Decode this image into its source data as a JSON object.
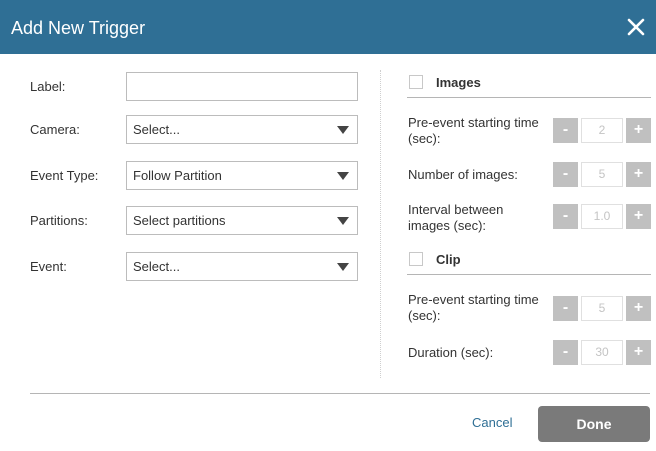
{
  "dialog": {
    "title": "Add New Trigger",
    "close_icon": "close-icon"
  },
  "form": {
    "label": {
      "label": "Label:",
      "value": "",
      "placeholder": ""
    },
    "camera": {
      "label": "Camera:",
      "value": "Select..."
    },
    "event_type": {
      "label": "Event Type:",
      "value": "Follow Partition"
    },
    "partitions": {
      "label": "Partitions:",
      "value": "Select partitions"
    },
    "event": {
      "label": "Event:",
      "value": "Select..."
    }
  },
  "images": {
    "title": "Images",
    "checked": false,
    "pre_event": {
      "label": "Pre-event starting time (sec):",
      "value": "2"
    },
    "count": {
      "label": "Number of images:",
      "value": "5"
    },
    "interval": {
      "label": "Interval between images (sec):",
      "value": "1.0"
    }
  },
  "clip": {
    "title": "Clip",
    "checked": false,
    "pre_event": {
      "label": "Pre-event starting time (sec):",
      "value": "5"
    },
    "duration": {
      "label": "Duration (sec):",
      "value": "30"
    }
  },
  "stepper": {
    "minus": "-",
    "plus": "+"
  },
  "footer": {
    "cancel": "Cancel",
    "done": "Done"
  },
  "colors": {
    "titlebar": "#2f6f95",
    "stepper_button": "#c0c0c0",
    "done_button": "#7a7a7a",
    "link": "#2f6f95"
  }
}
